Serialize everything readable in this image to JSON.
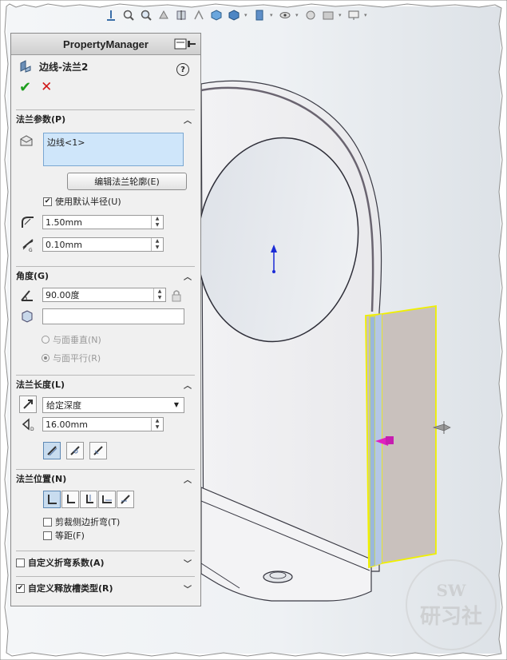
{
  "panel": {
    "header": "PropertyManager",
    "feature_title": "边线-法兰2",
    "help": "?"
  },
  "flange_params": {
    "title": "法兰参数(P)",
    "selection": "边线<1>",
    "edit_profile_button": "编辑法兰轮廓(E)",
    "use_default_radius": "使用默认半径(U)",
    "radius": "1.50mm",
    "gap": "0.10mm"
  },
  "angle": {
    "title": "角度(G)",
    "value": "90.00度",
    "face_field": "",
    "perpendicular": "与面垂直(N)",
    "parallel": "与面平行(R)"
  },
  "flange_length": {
    "title": "法兰长度(L)",
    "end_condition": "给定深度",
    "depth": "16.00mm"
  },
  "flange_position": {
    "title": "法兰位置(N)",
    "trim_side_bends": "剪裁侧边折弯(T)",
    "offset": "等距(F)"
  },
  "custom_bend": {
    "label": "自定义折弯系数(A)"
  },
  "custom_relief": {
    "label": "自定义释放槽类型(R)"
  },
  "watermark": {
    "line1": "SW",
    "line2": "研习社"
  },
  "colors": {
    "highlight": "#f0f000",
    "arrow_blue": "#1b2bd6",
    "arrow_magenta": "#e020c0",
    "annotation_red": "#d22020"
  }
}
